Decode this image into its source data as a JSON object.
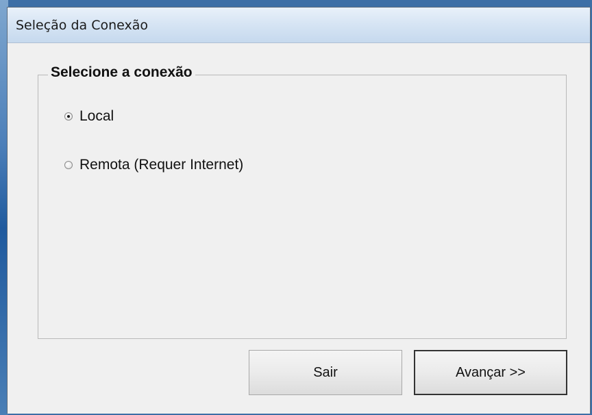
{
  "window": {
    "title": "Seleção da Conexão"
  },
  "connection_group": {
    "legend": "Selecione a conexão",
    "options": [
      {
        "label": "Local",
        "checked": true
      },
      {
        "label": "Remota (Requer Internet)",
        "checked": false
      }
    ]
  },
  "buttons": {
    "exit_label": "Sair",
    "next_label": "Avançar >>"
  },
  "colors": {
    "titlebar": "#d7e5f4",
    "client_background": "#f0f0f0"
  }
}
